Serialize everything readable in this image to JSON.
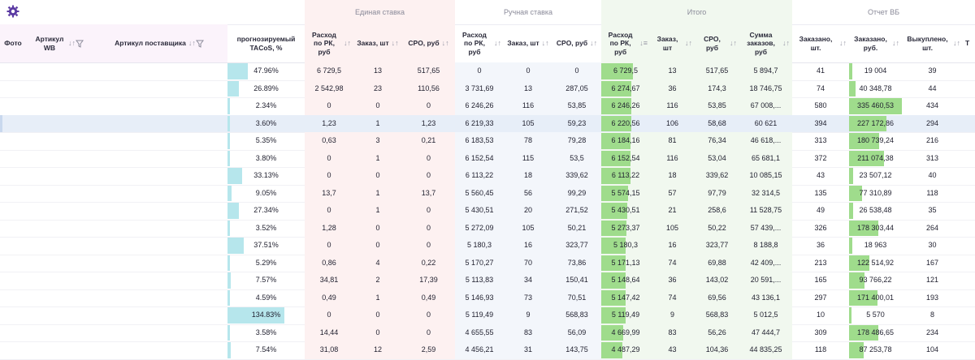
{
  "groups": {
    "single": "Единая ставка",
    "manual": "Ручная ставка",
    "total": "Итого",
    "wb": "Отчет ВБ"
  },
  "headers": {
    "photo": "Фото",
    "article_wb": "Артикул WB",
    "article_supplier": "Артикул поставщика",
    "tacos": "прогнозируемый TACoS, %",
    "s_spend": "Расход по РК, руб",
    "s_orders": "Заказ, шт",
    "s_cpo": "CPO, руб",
    "m_spend": "Расход по РК, руб",
    "m_orders": "Заказ, шт",
    "m_cpo": "CPO, руб",
    "t_spend": "Расход по РК, руб",
    "t_orders": "Заказ, шт",
    "t_cpo": "CPO, руб",
    "t_sum": "Сумма заказов, руб",
    "wb_ordered_qty": "Заказано, шт.",
    "wb_ordered_rub": "Заказано, руб.",
    "wb_bought": "Выкуплено, шт.",
    "cut": "Т"
  },
  "colors": {
    "accent_purple": "#5b3aa3",
    "tacos_bar": "#b6e6ec",
    "total_bar": "#9fdc8c",
    "wb_bar": "#9fdc8c",
    "single_tint": "#fdf1f1",
    "manual_tint": "#f3f6fb",
    "total_tint": "#f1f8ef",
    "selected_row": "#e7eef8"
  },
  "icons": {
    "settings": "gear-icon",
    "sort": "sort-icon",
    "filter": "filter-icon"
  },
  "selected_row": 3,
  "rows": [
    {
      "tacos": "47.96%",
      "tacos_frac": 0.35,
      "s_spend": "6 729,5",
      "s_orders": "13",
      "s_cpo": "517,65",
      "m_spend": "0",
      "m_orders": "0",
      "m_cpo": "0",
      "t_spend": "6 729,5",
      "t_spend_frac": 0.39,
      "t_orders": "13",
      "t_cpo": "517,65",
      "t_sum": "5 894,7",
      "wb_qty": "41",
      "wb_rub": "19 004",
      "wb_rub_frac": 0.06,
      "wb_bought": "39"
    },
    {
      "tacos": "26.89%",
      "tacos_frac": 0.2,
      "s_spend": "2 542,98",
      "s_orders": "23",
      "s_cpo": "110,56",
      "m_spend": "3 731,69",
      "m_orders": "13",
      "m_cpo": "287,05",
      "t_spend": "6 274,67",
      "t_spend_frac": 0.37,
      "t_orders": "36",
      "t_cpo": "174,3",
      "t_sum": "18 746,75",
      "wb_qty": "74",
      "wb_rub": "40 348,78",
      "wb_rub_frac": 0.12,
      "wb_bought": "44"
    },
    {
      "tacos": "2.34%",
      "tacos_frac": 0.02,
      "s_spend": "0",
      "s_orders": "0",
      "s_cpo": "0",
      "m_spend": "6 246,26",
      "m_orders": "116",
      "m_cpo": "53,85",
      "t_spend": "6 246,26",
      "t_spend_frac": 0.37,
      "t_orders": "116",
      "t_cpo": "53,85",
      "t_sum": "67 008,...",
      "wb_qty": "580",
      "wb_rub": "335 460,53",
      "wb_rub_frac": 1.0,
      "wb_bought": "434"
    },
    {
      "tacos": "3.60%",
      "tacos_frac": 0.03,
      "s_spend": "1,23",
      "s_orders": "1",
      "s_cpo": "1,23",
      "m_spend": "6 219,33",
      "m_orders": "105",
      "m_cpo": "59,23",
      "t_spend": "6 220,56",
      "t_spend_frac": 0.37,
      "t_orders": "106",
      "t_cpo": "58,68",
      "t_sum": "60 621",
      "wb_qty": "394",
      "wb_rub": "227 172,86",
      "wb_rub_frac": 0.68,
      "wb_bought": "294"
    },
    {
      "tacos": "5.35%",
      "tacos_frac": 0.04,
      "s_spend": "0,63",
      "s_orders": "3",
      "s_cpo": "0,21",
      "m_spend": "6 183,53",
      "m_orders": "78",
      "m_cpo": "79,28",
      "t_spend": "6 184,16",
      "t_spend_frac": 0.36,
      "t_orders": "81",
      "t_cpo": "76,34",
      "t_sum": "46 618,...",
      "wb_qty": "313",
      "wb_rub": "180 739,24",
      "wb_rub_frac": 0.54,
      "wb_bought": "216"
    },
    {
      "tacos": "3.80%",
      "tacos_frac": 0.03,
      "s_spend": "0",
      "s_orders": "1",
      "s_cpo": "0",
      "m_spend": "6 152,54",
      "m_orders": "115",
      "m_cpo": "53,5",
      "t_spend": "6 152,54",
      "t_spend_frac": 0.36,
      "t_orders": "116",
      "t_cpo": "53,04",
      "t_sum": "65 681,1",
      "wb_qty": "372",
      "wb_rub": "211 074,38",
      "wb_rub_frac": 0.63,
      "wb_bought": "313"
    },
    {
      "tacos": "33.13%",
      "tacos_frac": 0.25,
      "s_spend": "0",
      "s_orders": "0",
      "s_cpo": "0",
      "m_spend": "6 113,22",
      "m_orders": "18",
      "m_cpo": "339,62",
      "t_spend": "6 113,22",
      "t_spend_frac": 0.36,
      "t_orders": "18",
      "t_cpo": "339,62",
      "t_sum": "10 085,15",
      "wb_qty": "43",
      "wb_rub": "23 507,12",
      "wb_rub_frac": 0.07,
      "wb_bought": "40"
    },
    {
      "tacos": "9.05%",
      "tacos_frac": 0.07,
      "s_spend": "13,7",
      "s_orders": "1",
      "s_cpo": "13,7",
      "m_spend": "5 560,45",
      "m_orders": "56",
      "m_cpo": "99,29",
      "t_spend": "5 574,15",
      "t_spend_frac": 0.33,
      "t_orders": "57",
      "t_cpo": "97,79",
      "t_sum": "32 314,5",
      "wb_qty": "135",
      "wb_rub": "77 310,89",
      "wb_rub_frac": 0.23,
      "wb_bought": "118"
    },
    {
      "tacos": "27.34%",
      "tacos_frac": 0.2,
      "s_spend": "0",
      "s_orders": "1",
      "s_cpo": "0",
      "m_spend": "5 430,51",
      "m_orders": "20",
      "m_cpo": "271,52",
      "t_spend": "5 430,51",
      "t_spend_frac": 0.32,
      "t_orders": "21",
      "t_cpo": "258,6",
      "t_sum": "11 528,75",
      "wb_qty": "49",
      "wb_rub": "26 538,48",
      "wb_rub_frac": 0.08,
      "wb_bought": "35"
    },
    {
      "tacos": "3.52%",
      "tacos_frac": 0.03,
      "s_spend": "1,28",
      "s_orders": "0",
      "s_cpo": "0",
      "m_spend": "5 272,09",
      "m_orders": "105",
      "m_cpo": "50,21",
      "t_spend": "5 273,37",
      "t_spend_frac": 0.31,
      "t_orders": "105",
      "t_cpo": "50,22",
      "t_sum": "57 439,...",
      "wb_qty": "326",
      "wb_rub": "178 303,44",
      "wb_rub_frac": 0.53,
      "wb_bought": "264"
    },
    {
      "tacos": "37.51%",
      "tacos_frac": 0.28,
      "s_spend": "0",
      "s_orders": "0",
      "s_cpo": "0",
      "m_spend": "5 180,3",
      "m_orders": "16",
      "m_cpo": "323,77",
      "t_spend": "5 180,3",
      "t_spend_frac": 0.3,
      "t_orders": "16",
      "t_cpo": "323,77",
      "t_sum": "8 188,8",
      "wb_qty": "36",
      "wb_rub": "18 963",
      "wb_rub_frac": 0.06,
      "wb_bought": "30"
    },
    {
      "tacos": "5.29%",
      "tacos_frac": 0.04,
      "s_spend": "0,86",
      "s_orders": "4",
      "s_cpo": "0,22",
      "m_spend": "5 170,27",
      "m_orders": "70",
      "m_cpo": "73,86",
      "t_spend": "5 171,13",
      "t_spend_frac": 0.3,
      "t_orders": "74",
      "t_cpo": "69,88",
      "t_sum": "42 409,...",
      "wb_qty": "213",
      "wb_rub": "122 514,92",
      "wb_rub_frac": 0.37,
      "wb_bought": "167"
    },
    {
      "tacos": "7.57%",
      "tacos_frac": 0.06,
      "s_spend": "34,81",
      "s_orders": "2",
      "s_cpo": "17,39",
      "m_spend": "5 113,83",
      "m_orders": "34",
      "m_cpo": "150,41",
      "t_spend": "5 148,64",
      "t_spend_frac": 0.3,
      "t_orders": "36",
      "t_cpo": "143,02",
      "t_sum": "20 591,...",
      "wb_qty": "165",
      "wb_rub": "93 766,22",
      "wb_rub_frac": 0.28,
      "wb_bought": "121"
    },
    {
      "tacos": "4.59%",
      "tacos_frac": 0.03,
      "s_spend": "0,49",
      "s_orders": "1",
      "s_cpo": "0,49",
      "m_spend": "5 146,93",
      "m_orders": "73",
      "m_cpo": "70,51",
      "t_spend": "5 147,42",
      "t_spend_frac": 0.3,
      "t_orders": "74",
      "t_cpo": "69,56",
      "t_sum": "43 136,1",
      "wb_qty": "297",
      "wb_rub": "171 400,01",
      "wb_rub_frac": 0.51,
      "wb_bought": "193"
    },
    {
      "tacos": "134.83%",
      "tacos_frac": 1.0,
      "s_spend": "0",
      "s_orders": "0",
      "s_cpo": "0",
      "m_spend": "5 119,49",
      "m_orders": "9",
      "m_cpo": "568,83",
      "t_spend": "5 119,49",
      "t_spend_frac": 0.3,
      "t_orders": "9",
      "t_cpo": "568,83",
      "t_sum": "5 012,5",
      "wb_qty": "10",
      "wb_rub": "5 570",
      "wb_rub_frac": 0.02,
      "wb_bought": "8"
    },
    {
      "tacos": "3.58%",
      "tacos_frac": 0.03,
      "s_spend": "14,44",
      "s_orders": "0",
      "s_cpo": "0",
      "m_spend": "4 655,55",
      "m_orders": "83",
      "m_cpo": "56,09",
      "t_spend": "4 669,99",
      "t_spend_frac": 0.27,
      "t_orders": "83",
      "t_cpo": "56,26",
      "t_sum": "47 444,7",
      "wb_qty": "309",
      "wb_rub": "178 486,65",
      "wb_rub_frac": 0.53,
      "wb_bought": "234"
    },
    {
      "tacos": "7.54%",
      "tacos_frac": 0.06,
      "s_spend": "31,08",
      "s_orders": "12",
      "s_cpo": "2,59",
      "m_spend": "4 456,21",
      "m_orders": "31",
      "m_cpo": "143,75",
      "t_spend": "4 487,29",
      "t_spend_frac": 0.26,
      "t_orders": "43",
      "t_cpo": "104,36",
      "t_sum": "44 835,25",
      "wb_qty": "118",
      "wb_rub": "87 253,78",
      "wb_rub_frac": 0.26,
      "wb_bought": "104"
    }
  ]
}
